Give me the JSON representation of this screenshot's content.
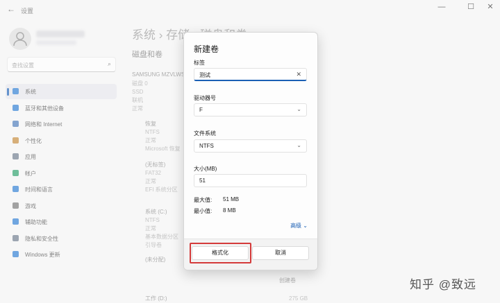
{
  "window": {
    "title": "设置",
    "back_glyph": "←",
    "minimize": "—",
    "maximize": "☐",
    "close": "✕"
  },
  "sidebar": {
    "search_placeholder": "查找设置",
    "items": [
      {
        "label": "系统",
        "icon": "monitor-icon",
        "color": "#2d7dd2"
      },
      {
        "label": "蓝牙和其他设备",
        "icon": "bluetooth-icon",
        "color": "#2d7dd2"
      },
      {
        "label": "网络和 Internet",
        "icon": "wifi-icon",
        "color": "#4a7ab8"
      },
      {
        "label": "个性化",
        "icon": "brush-icon",
        "color": "#c48a3a"
      },
      {
        "label": "应用",
        "icon": "apps-icon",
        "color": "#6d7b8c"
      },
      {
        "label": "帐户",
        "icon": "person-icon",
        "color": "#2ba06a"
      },
      {
        "label": "时间和语言",
        "icon": "globe-icon",
        "color": "#2d7dd2"
      },
      {
        "label": "游戏",
        "icon": "gamepad-icon",
        "color": "#777777"
      },
      {
        "label": "辅助功能",
        "icon": "accessibility-icon",
        "color": "#2d7dd2"
      },
      {
        "label": "隐私和安全性",
        "icon": "shield-icon",
        "color": "#6d7b8c"
      },
      {
        "label": "Windows 更新",
        "icon": "update-icon",
        "color": "#2d7dd2"
      }
    ]
  },
  "content": {
    "breadcrumb": "系统  ›  存储  ›  磁盘和卷",
    "section": "磁盘和卷",
    "disk": {
      "name": "SAMSUNG MZVLWS",
      "num": "磁盘 0",
      "type": "SSD",
      "status1": "联机",
      "status2": "正常"
    },
    "volumes": [
      {
        "name": "恢复",
        "fs": "NTFS",
        "state": "正常",
        "part": "Microsoft 恢复"
      },
      {
        "name": "(无标签)",
        "fs": "FAT32",
        "state": "正常",
        "part": "EFI 系统分区"
      },
      {
        "name": "系统 (C:)",
        "fs": "NTFS",
        "state": "正常",
        "part": "基本数据分区",
        "boot": "引导卷"
      },
      {
        "name": "(未分配)"
      }
    ],
    "create_volume": "创建卷",
    "last_row": {
      "name": "工作 (D:)",
      "size": "275 GB"
    }
  },
  "dialog": {
    "title": "新建卷",
    "label_field": {
      "label": "标签",
      "value": "测试"
    },
    "drive_letter": {
      "label": "驱动器号",
      "value": "F"
    },
    "file_system": {
      "label": "文件系统",
      "value": "NTFS"
    },
    "size": {
      "label": "大小(MB)",
      "value": "51"
    },
    "max": {
      "label": "最大值:",
      "value": "51 MB"
    },
    "min": {
      "label": "最小值:",
      "value": "8 MB"
    },
    "advanced": "高级",
    "format_button": "格式化",
    "cancel_button": "取消"
  },
  "watermark": "知乎 @致远",
  "colors": {
    "accent": "#1a5fb4",
    "highlight": "#d43a3a"
  }
}
